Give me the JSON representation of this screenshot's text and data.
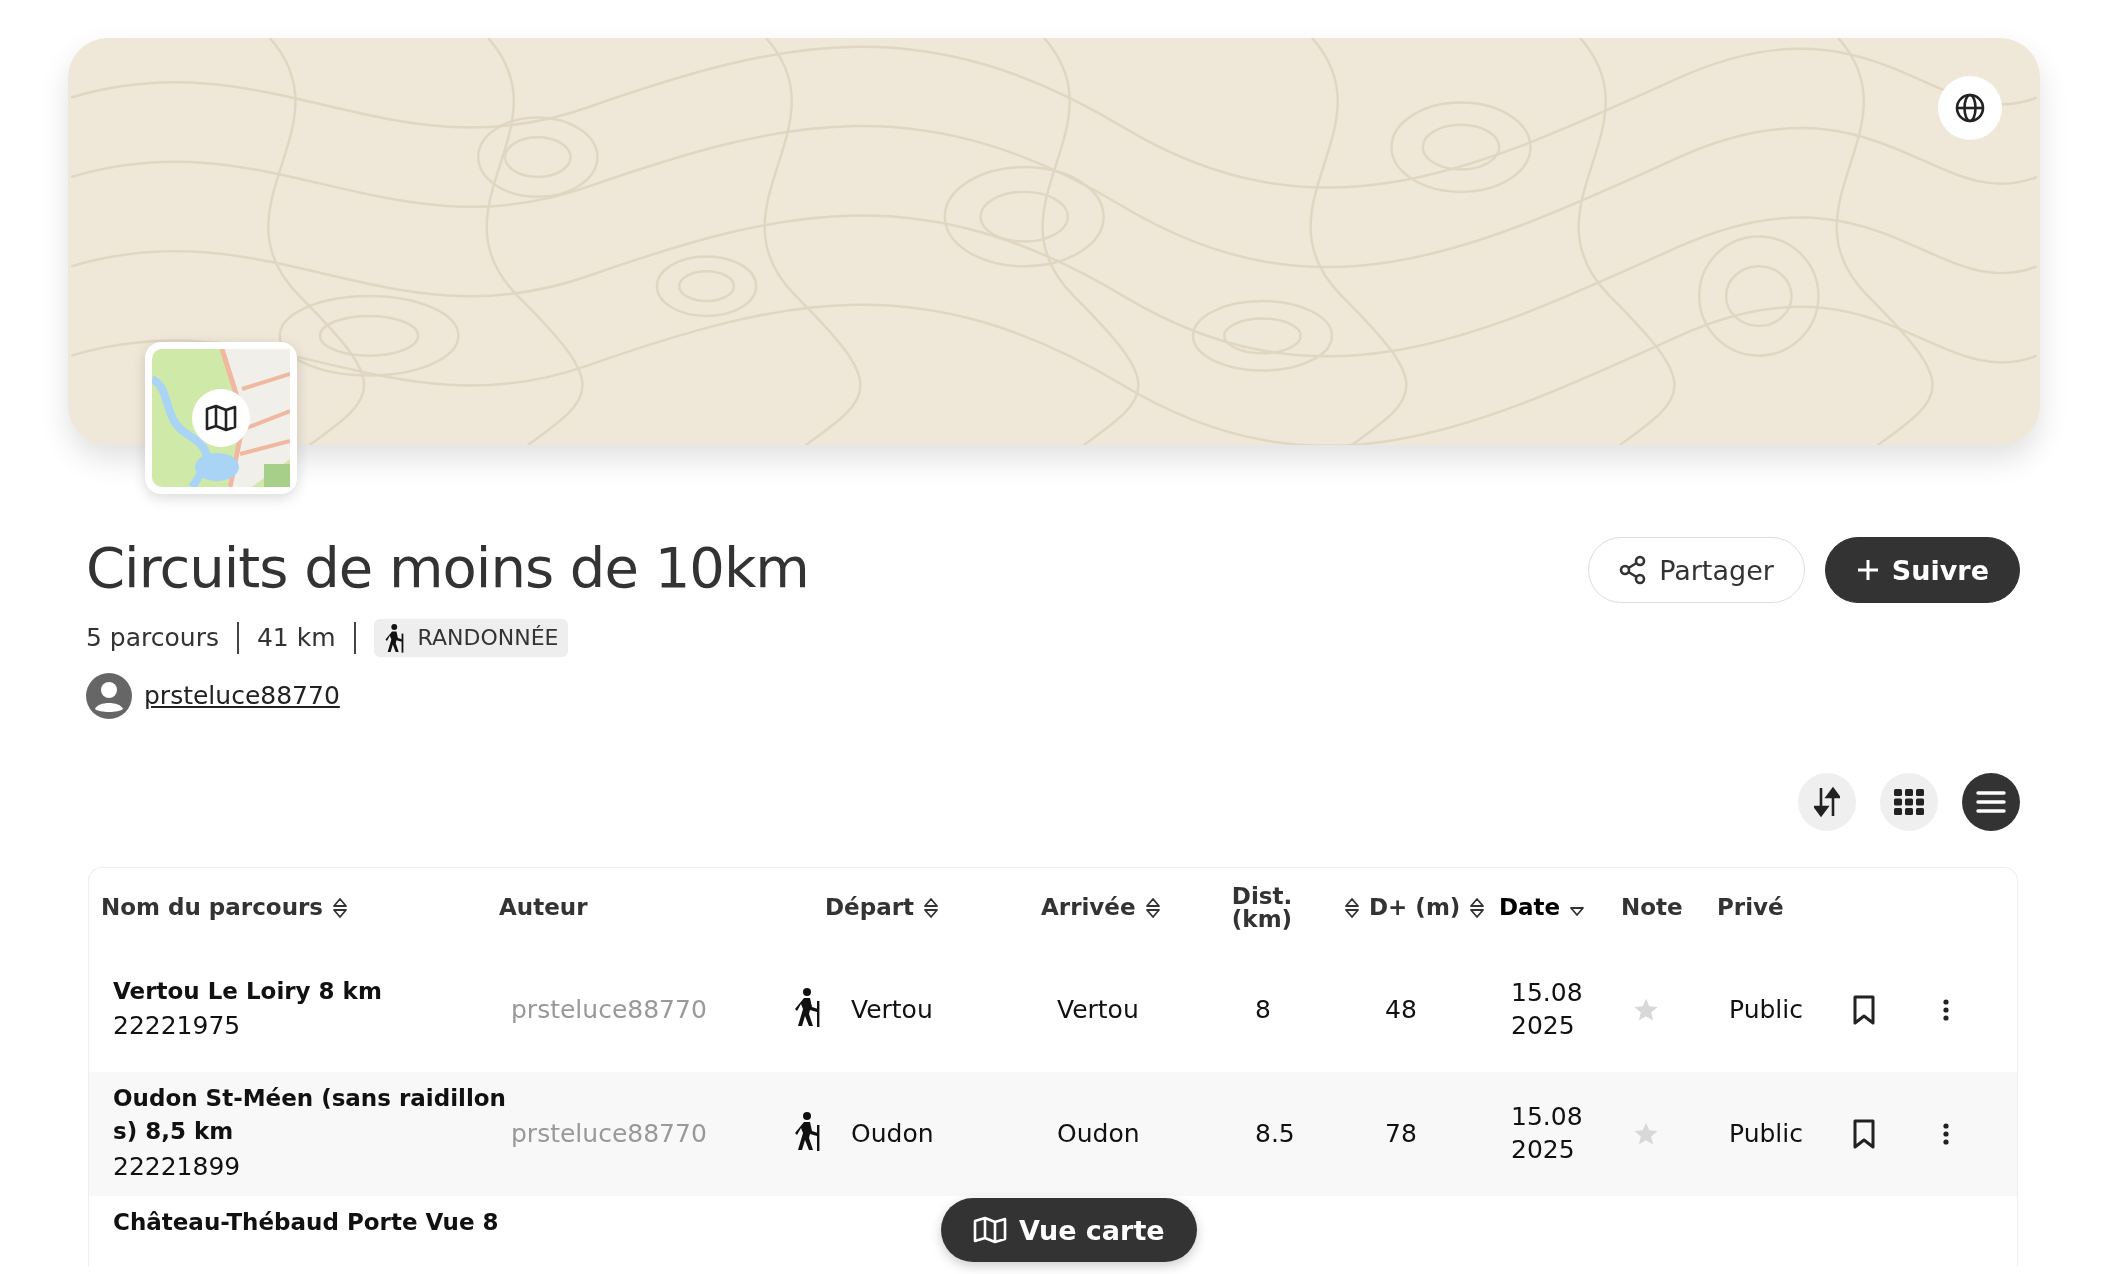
{
  "collection": {
    "title": "Circuits de moins de 10km",
    "stats": [
      "5 parcours",
      "41 km"
    ],
    "activity": "RANDONNÉE",
    "author": "prsteluce88770"
  },
  "actions": [
    {
      "label": "Partager",
      "kind": "share"
    },
    {
      "label": "Suivre",
      "kind": "follow"
    }
  ],
  "view_controls": [
    {
      "kind": "sort",
      "selected": false
    },
    {
      "kind": "grid",
      "selected": false
    },
    {
      "kind": "list",
      "selected": true
    }
  ],
  "table": {
    "columns": [
      {
        "label": "Nom du parcours",
        "sortable": true,
        "sorted": false
      },
      {
        "label": "Auteur",
        "sortable": false,
        "sorted": false
      },
      {
        "label": "Départ",
        "sortable": true,
        "sorted": false
      },
      {
        "label": "Arrivée",
        "sortable": true,
        "sorted": false
      },
      {
        "label": "Dist. (km)",
        "sortable": true,
        "sorted": false
      },
      {
        "label": "D+ (m)",
        "sortable": true,
        "sorted": false
      },
      {
        "label": "Date",
        "sortable": true,
        "sorted": true
      },
      {
        "label": "Note",
        "sortable": false,
        "sorted": false
      },
      {
        "label": "Privé",
        "sortable": false,
        "sorted": false
      }
    ],
    "rows": [
      {
        "name": "Vertou Le Loiry 8 km",
        "id": "22221975",
        "author": "prsteluce88770",
        "start": "Vertou",
        "end": "Vertou",
        "distance": "8",
        "elevation": "48",
        "date": "15.08 2025",
        "visibility": "Public",
        "bookmarked": false
      },
      {
        "name": "Oudon St-Méen (sans raidillons) 8,5 km",
        "id": "22221899",
        "author": "prsteluce88770",
        "start": "Oudon",
        "end": "Oudon",
        "distance": "8.5",
        "elevation": "78",
        "date": "15.08 2025",
        "visibility": "Public",
        "bookmarked": false
      },
      {
        "name": "Château-Thébaud Porte Vue 8"
      }
    ]
  },
  "map_button": {
    "label": "Vue carte"
  }
}
